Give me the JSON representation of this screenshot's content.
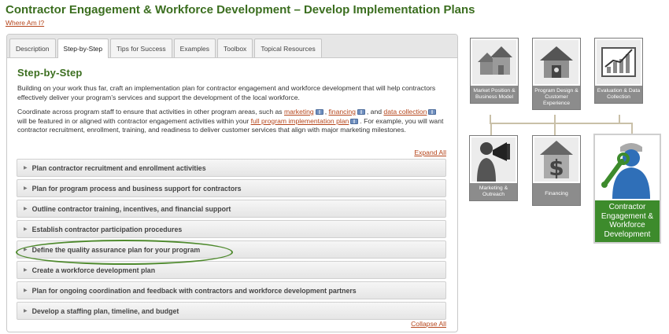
{
  "page": {
    "title": "Contractor Engagement & Workforce Development – Develop Implementation Plans",
    "where_link": "Where Am I?"
  },
  "tabs": [
    {
      "label": "Description"
    },
    {
      "label": "Step-by-Step"
    },
    {
      "label": "Tips for Success"
    },
    {
      "label": "Examples"
    },
    {
      "label": "Toolbox"
    },
    {
      "label": "Topical Resources"
    }
  ],
  "active_tab": "Step-by-Step",
  "content": {
    "heading": "Step-by-Step",
    "para1": "Building on your work thus far, craft an implementation plan for contractor engagement and workforce development that will help contractors effectively deliver your program’s services and support the development of the local workforce.",
    "para2": {
      "t1": "Coordinate across program staff to ensure that activities in other program areas, such as ",
      "link_marketing": "marketing",
      "t2": ", ",
      "link_financing": "financing",
      "t3": ", and ",
      "link_data": "data collection",
      "t4": " will be featured in or aligned with contractor engagement activities within your ",
      "link_full": "full program implementation plan",
      "t5": ". For example, you will want contractor recruitment, enrollment, training, and readiness to deliver customer services that align with major marketing milestones."
    },
    "expand_all": "Expand All",
    "collapse_all": "Collapse All"
  },
  "accordion": [
    {
      "label": "Plan contractor recruitment and enrollment activities"
    },
    {
      "label": "Plan for program process and business support for contractors"
    },
    {
      "label": "Outline contractor training, incentives, and financial support"
    },
    {
      "label": "Establish contractor participation procedures"
    },
    {
      "label": "Define the quality assurance plan for your program"
    },
    {
      "label": "Create a workforce development plan"
    },
    {
      "label": "Plan for ongoing coordination and feedback with contractors and workforce development partners"
    },
    {
      "label": "Develop a staffing plan, timeline, and budget"
    }
  ],
  "diagram": {
    "market": "Market Position & Business Model",
    "design": "Program Design & Customer Experience",
    "evaluation": "Evaluation & Data Collection",
    "marketing": "Marketing & Outreach",
    "financing": "Financing",
    "contractor": "Contractor Engagement & Workforce Development"
  },
  "colors": {
    "title_green": "#3b6e1f",
    "link_orange": "#b5451b",
    "highlight_green": "#3d8b2c",
    "tile_gray": "#8c8c8c"
  }
}
